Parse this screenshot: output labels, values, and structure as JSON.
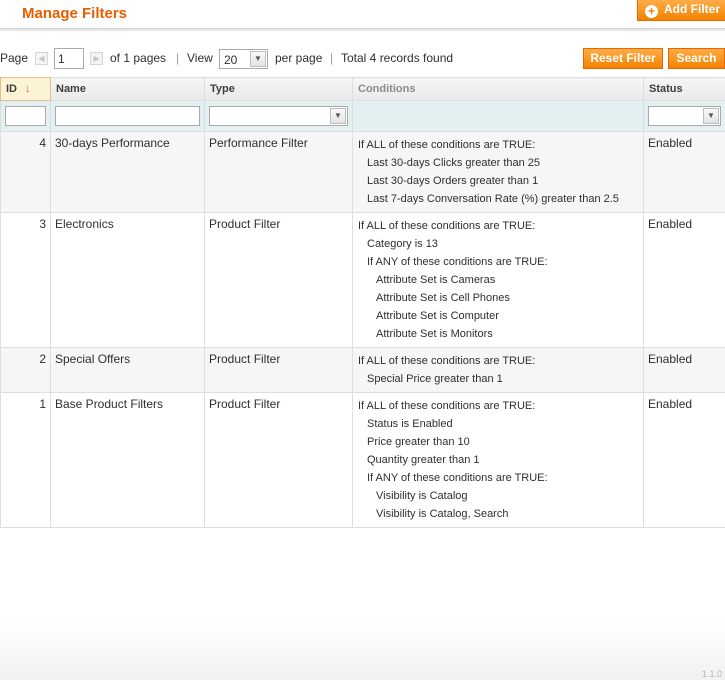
{
  "header": {
    "title": "Manage Filters",
    "add_button": "Add Filter"
  },
  "pager": {
    "page_label": "Page",
    "page_value": "1",
    "of_pages": "of 1 pages",
    "view_label": "View",
    "per_page_value": "20",
    "per_page_label": "per page",
    "records": "Total 4 records found"
  },
  "actions": {
    "reset": "Reset Filter",
    "search": "Search"
  },
  "columns": {
    "id": "ID",
    "name": "Name",
    "type": "Type",
    "conditions": "Conditions",
    "status": "Status"
  },
  "rows": [
    {
      "id": "4",
      "name": "30-days Performance",
      "type": "Performance Filter",
      "status": "Enabled",
      "conditions": [
        {
          "text": "If ALL of these conditions are TRUE:",
          "level": 0
        },
        {
          "text": "Last 30-days Clicks greater than 25",
          "level": 1
        },
        {
          "text": "Last 30-days Orders greater than 1",
          "level": 1
        },
        {
          "text": "Last 7-days Conversation Rate (%) greater than 2.5",
          "level": 1
        }
      ]
    },
    {
      "id": "3",
      "name": "Electronics",
      "type": "Product Filter",
      "status": "Enabled",
      "conditions": [
        {
          "text": "If ALL of these conditions are TRUE:",
          "level": 0
        },
        {
          "text": "Category is 13",
          "level": 1
        },
        {
          "text": "If ANY of these conditions are TRUE:",
          "level": 1
        },
        {
          "text": "Attribute Set is Cameras",
          "level": 2
        },
        {
          "text": "Attribute Set is Cell Phones",
          "level": 2
        },
        {
          "text": "Attribute Set is Computer",
          "level": 2
        },
        {
          "text": "Attribute Set is Monitors",
          "level": 2
        }
      ]
    },
    {
      "id": "2",
      "name": "Special Offers",
      "type": "Product Filter",
      "status": "Enabled",
      "conditions": [
        {
          "text": "If ALL of these conditions are TRUE:",
          "level": 0
        },
        {
          "text": "Special Price greater than 1",
          "level": 1
        }
      ]
    },
    {
      "id": "1",
      "name": "Base Product Filters",
      "type": "Product Filter",
      "status": "Enabled",
      "conditions": [
        {
          "text": "If ALL of these conditions are TRUE:",
          "level": 0
        },
        {
          "text": "Status is Enabled",
          "level": 1
        },
        {
          "text": "Price greater than 10",
          "level": 1
        },
        {
          "text": "Quantity greater than 1",
          "level": 1
        },
        {
          "text": "If ANY of these conditions are TRUE:",
          "level": 1
        },
        {
          "text": "Visibility is Catalog",
          "level": 2
        },
        {
          "text": "Visibility is Catalog, Search",
          "level": 2
        }
      ]
    }
  ],
  "footer": {
    "version": "1.1.0"
  },
  "colors": {
    "accent": "#eb5e00",
    "button": "#f18200",
    "filter_row": "#e3eff1"
  }
}
